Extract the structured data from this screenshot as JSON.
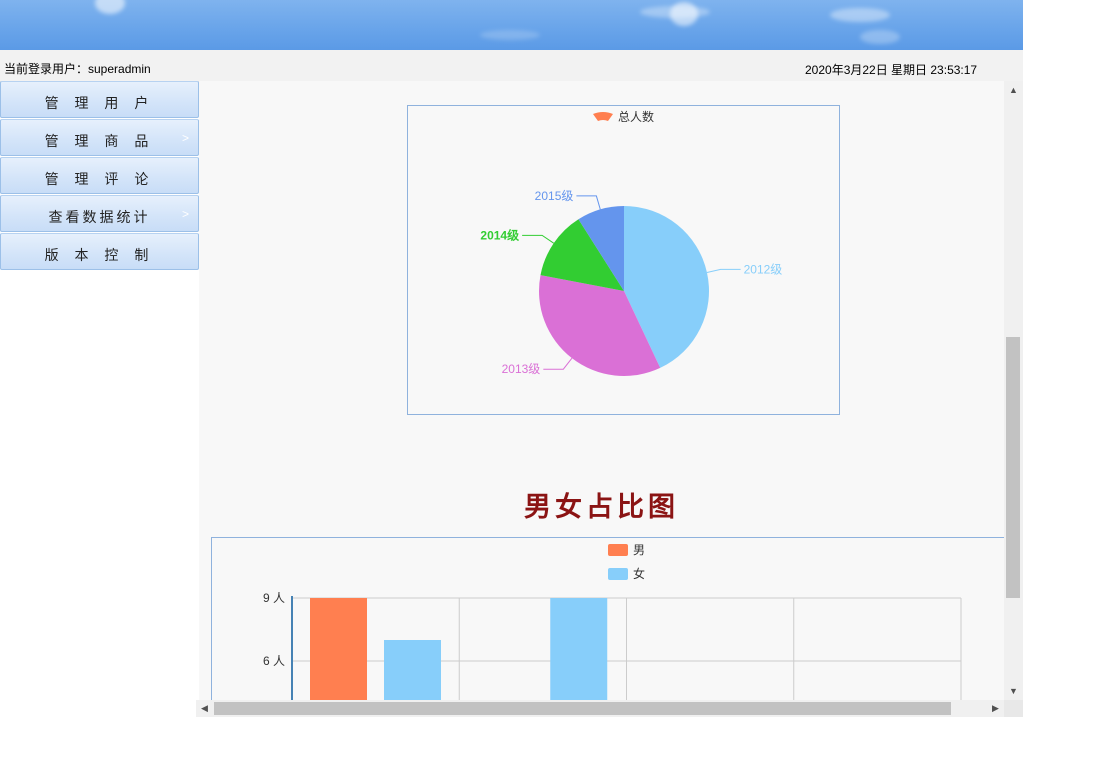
{
  "header": {
    "login_label": "当前登录用户：superadmin",
    "datetime": "2020年3月22日 星期日 23:53:17"
  },
  "sidebar": {
    "items": [
      {
        "label": "管 理 用 户",
        "has_arrow": false
      },
      {
        "label": "管 理 商 品",
        "has_arrow": true
      },
      {
        "label": "管 理 评 论",
        "has_arrow": false
      },
      {
        "label": "查看数据统计",
        "has_arrow": true
      },
      {
        "label": "版 本 控 制",
        "has_arrow": false
      }
    ],
    "arrow_glyph": ">"
  },
  "bar_chart_title": "男女占比图",
  "chart_data": [
    {
      "type": "pie",
      "legend": [
        "总人数"
      ],
      "legend_position": "top-center",
      "slices": [
        {
          "label": "2012级",
          "value": 43,
          "color": "#87cefa"
        },
        {
          "label": "2013级",
          "value": 35,
          "color": "#da70d6"
        },
        {
          "label": "2014级",
          "value": 13,
          "color": "#32cd32"
        },
        {
          "label": "2015级",
          "value": 9,
          "color": "#6495ed"
        }
      ]
    },
    {
      "type": "bar",
      "title": "男女占比图",
      "categories": [
        "",
        "",
        "",
        ""
      ],
      "series": [
        {
          "name": "男",
          "color": "#ff7f50",
          "values": [
            9,
            0,
            null,
            null
          ]
        },
        {
          "name": "女",
          "color": "#87cefa",
          "values": [
            7,
            9,
            null,
            null
          ]
        }
      ],
      "y_ticks": [
        "6 人",
        "9 人"
      ],
      "ylim": [
        3,
        9
      ],
      "legend_position": "top-center",
      "grid": true
    }
  ]
}
